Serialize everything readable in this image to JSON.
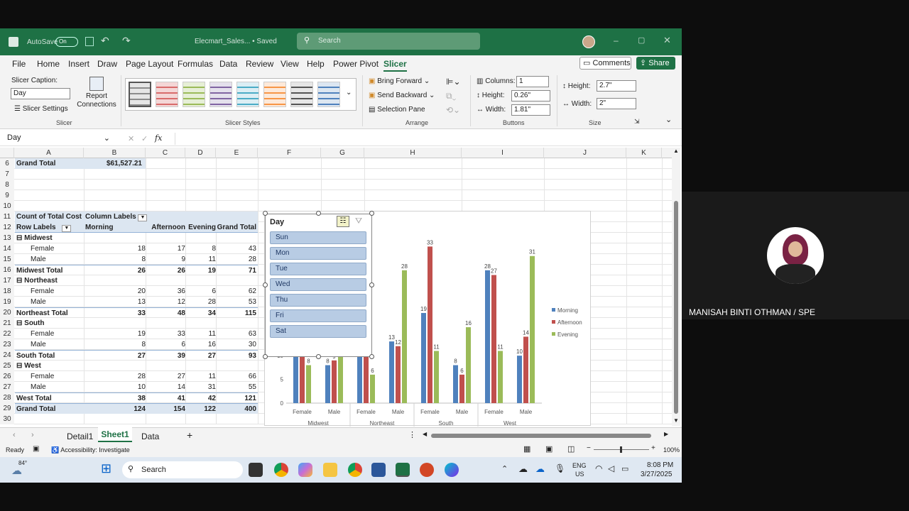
{
  "titlebar": {
    "autosave": "AutoSave",
    "autosave_state": "On",
    "filename": "Elecmart_Sales... • Saved",
    "search_placeholder": "Search"
  },
  "menu": [
    "File",
    "Home",
    "Insert",
    "Draw",
    "Page Layout",
    "Formulas",
    "Data",
    "Review",
    "View",
    "Help",
    "Power Pivot",
    "Slicer"
  ],
  "menu_active": "Slicer",
  "comments_label": "Comments",
  "share_label": "Share",
  "ribbon": {
    "slicer_caption_label": "Slicer Caption:",
    "slicer_caption_value": "Day",
    "slicer_settings": "Slicer Settings",
    "report_connections": "Report Connections",
    "group_slicer": "Slicer",
    "group_styles": "Slicer Styles",
    "bring_forward": "Bring Forward",
    "send_backward": "Send Backward",
    "selection_pane": "Selection Pane",
    "group_arrange": "Arrange",
    "columns_label": "Columns:",
    "columns_value": "1",
    "btn_height_label": "Height:",
    "btn_height_value": "0.26\"",
    "btn_width_label": "Width:",
    "btn_width_value": "1.81\"",
    "group_buttons": "Buttons",
    "size_height_label": "Height:",
    "size_height_value": "2.7\"",
    "size_width_label": "Width:",
    "size_width_value": "2\"",
    "group_size": "Size"
  },
  "namebox": "Day",
  "columns": [
    "A",
    "B",
    "C",
    "D",
    "E",
    "F",
    "G",
    "H",
    "I",
    "J",
    "K"
  ],
  "rows": [
    "6",
    "7",
    "8",
    "9",
    "10",
    "11",
    "12",
    "13",
    "14",
    "15",
    "16",
    "17",
    "18",
    "19",
    "20",
    "21",
    "22",
    "23",
    "24",
    "25",
    "26",
    "27",
    "28",
    "29",
    "30"
  ],
  "grand_total_label": "Grand Total",
  "grand_total_value": "$61,527.21",
  "pivot": {
    "hdr1": [
      "Count of Total Cost",
      "Column Labels"
    ],
    "hdr2": [
      "Row Labels",
      "Morning",
      "Afternoon",
      "Evening",
      "Grand Total"
    ],
    "body": [
      [
        "⊟ Midwest",
        "",
        "",
        "",
        ""
      ],
      [
        "Female",
        "18",
        "17",
        "8",
        "43"
      ],
      [
        "Male",
        "8",
        "9",
        "11",
        "28"
      ],
      [
        "Midwest Total",
        "26",
        "26",
        "19",
        "71"
      ],
      [
        "⊟ Northeast",
        "",
        "",
        "",
        ""
      ],
      [
        "Female",
        "20",
        "36",
        "6",
        "62"
      ],
      [
        "Male",
        "13",
        "12",
        "28",
        "53"
      ],
      [
        "Northeast Total",
        "33",
        "48",
        "34",
        "115"
      ],
      [
        "⊟ South",
        "",
        "",
        "",
        ""
      ],
      [
        "Female",
        "19",
        "33",
        "11",
        "63"
      ],
      [
        "Male",
        "8",
        "6",
        "16",
        "30"
      ],
      [
        "South Total",
        "27",
        "39",
        "27",
        "93"
      ],
      [
        "⊟ West",
        "",
        "",
        "",
        ""
      ],
      [
        "Female",
        "28",
        "27",
        "11",
        "66"
      ],
      [
        "Male",
        "10",
        "14",
        "31",
        "55"
      ],
      [
        "West Total",
        "38",
        "41",
        "42",
        "121"
      ],
      [
        "Grand Total",
        "124",
        "154",
        "122",
        "400"
      ]
    ]
  },
  "slicer": {
    "title": "Day",
    "items": [
      "Sun",
      "Mon",
      "Tue",
      "Wed",
      "Thu",
      "Fri",
      "Sat"
    ]
  },
  "chart_data": {
    "type": "bar",
    "categories": [
      "Female",
      "Male",
      "Female",
      "Male",
      "Female",
      "Male",
      "Female",
      "Male"
    ],
    "groups": [
      "Midwest",
      "Northeast",
      "South",
      "West"
    ],
    "series": [
      {
        "name": "Morning",
        "color": "#4f81bd",
        "values": [
          18,
          8,
          20,
          13,
          19,
          8,
          28,
          10
        ]
      },
      {
        "name": "Afternoon",
        "color": "#c0504d",
        "values": [
          17,
          9,
          36,
          12,
          33,
          6,
          27,
          14
        ]
      },
      {
        "name": "Evening",
        "color": "#9bbb59",
        "values": [
          8,
          11,
          6,
          28,
          11,
          16,
          11,
          31
        ]
      }
    ],
    "y_ticks": [
      "0",
      "5",
      "10"
    ],
    "ylim": [
      0,
      35
    ],
    "legend_position": "right"
  },
  "sheet_tabs": [
    "Detail1",
    "Sheet1",
    "Data"
  ],
  "active_sheet": "Sheet1",
  "status": {
    "ready": "Ready",
    "accessibility": "Accessibility: Investigate",
    "zoom": "100%"
  },
  "taskbar": {
    "temp": "84°",
    "search": "Search",
    "lang1": "ENG",
    "lang2": "US",
    "time": "8:08 PM",
    "date": "3/27/2025"
  },
  "presenter_name": "MANISAH BINTI OTHMAN / SPE"
}
